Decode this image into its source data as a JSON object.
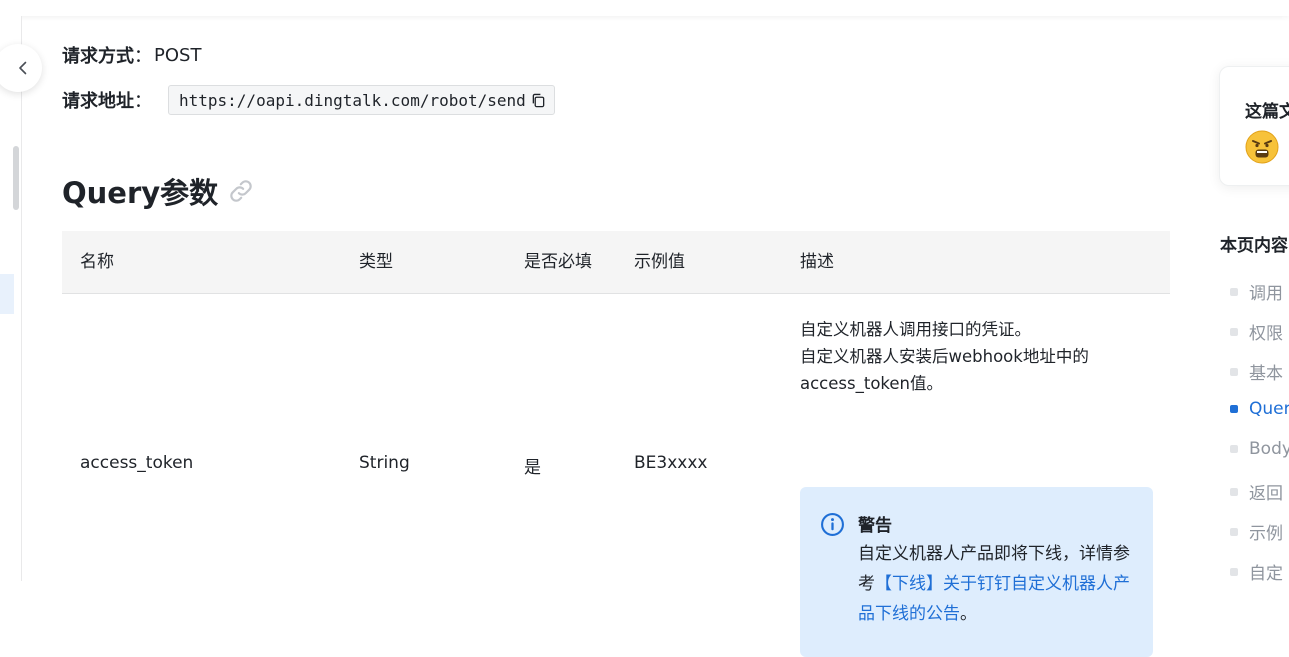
{
  "request": {
    "method_label": "请求方式",
    "method_sep": "：",
    "method_value": "POST",
    "url_label": "请求地址",
    "url_sep": "：",
    "url_value": "https://oapi.dingtalk.com/robot/send"
  },
  "section": {
    "title": "Query参数",
    "icon": "link-icon"
  },
  "table": {
    "headers": [
      "名称",
      "类型",
      "是否必填",
      "示例值",
      "描述"
    ],
    "rows": [
      {
        "name": "access_token",
        "type": "String",
        "required": "是",
        "example": "BE3xxxx",
        "description": [
          "自定义机器人调用接口的凭证。",
          "自定义机器人安装后webhook地址中的",
          "access_token值。"
        ],
        "warning": {
          "title": "警告",
          "text_before": "自定义机器人产品即将下线，详情参考",
          "link_text": "【下线】关于钉钉自定义机器人产品下线的公告",
          "text_after": "。"
        }
      }
    ]
  },
  "feedback": {
    "title": "这篇文",
    "emoji": "angry-face-icon"
  },
  "toc": {
    "title": "本页内容",
    "items": [
      "调用",
      "权限",
      "基本",
      "Quer",
      "Body",
      "返回",
      "示例",
      "自定"
    ],
    "active_index": 3
  },
  "colors": {
    "accent": "#1f6fd6",
    "warning_bg": "#deedfd",
    "header_bg": "#f5f5f5"
  }
}
